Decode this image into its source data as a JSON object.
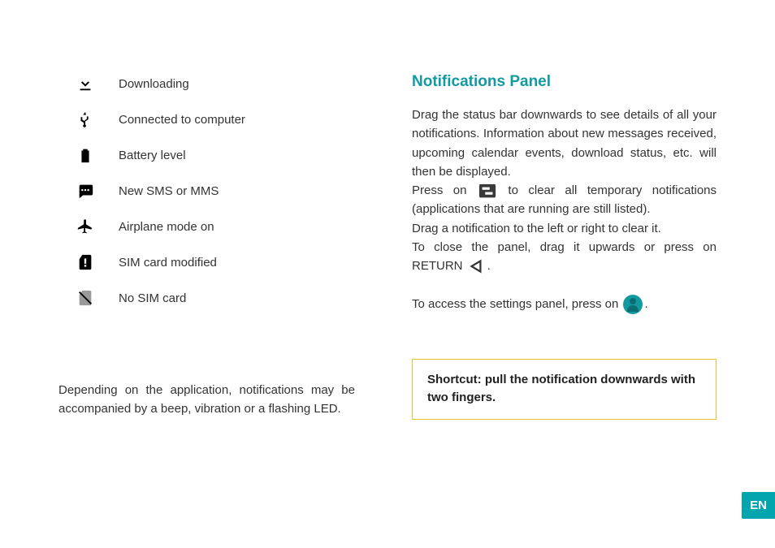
{
  "left": {
    "icons": [
      {
        "name": "download-icon",
        "label": "Downloading"
      },
      {
        "name": "usb-icon",
        "label": "Connected to computer"
      },
      {
        "name": "battery-icon",
        "label": "Battery level"
      },
      {
        "name": "sms-icon",
        "label": "New SMS or MMS"
      },
      {
        "name": "airplane-icon",
        "label": "Airplane mode on"
      },
      {
        "name": "sim-modified-icon",
        "label": "SIM card modified"
      },
      {
        "name": "no-sim-icon",
        "label": "No SIM card"
      }
    ],
    "note": "Depending on the application, notifications may be accompanied by a beep, vibration or a flashing LED."
  },
  "right": {
    "heading": "Notifications Panel",
    "p1": "Drag the status bar downwards to see details of all your notifications. Information about new messages received, upcoming calendar events, download status, etc. will then be displayed.",
    "p2a": "Press on ",
    "p2b": " to clear all temporary notifications (applications that are running are still listed).",
    "p3": "Drag a notification to the left or right to clear it.",
    "p4a": "To close the panel, drag it upwards or press on RETURN ",
    "p4b": ".",
    "p5a": "To access the settings panel, press on ",
    "p5b": ".",
    "callout": "Shortcut: pull the notification downwards with two fingers."
  },
  "lang": "EN"
}
